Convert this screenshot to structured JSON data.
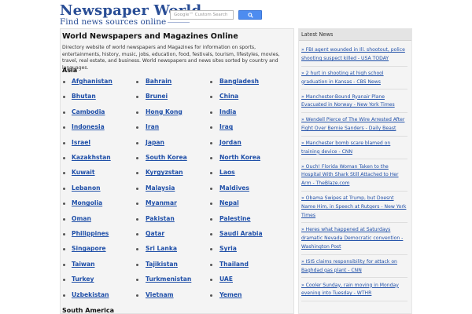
{
  "header": {
    "logo_title": "Newspaper World",
    "logo_subtitle": "Find news sources online",
    "search_placeholder": "Google™ Custom Search"
  },
  "main": {
    "title": "World Newspapers and Magazines Online",
    "intro": "Directory website of world newspapers and Magazines for information on sports, entertainments, history, music, jobs, education, food, festivals, tourism, lifestyles, movies, travel, real estate, and business. World newspapers and news sites sorted by country and languages.",
    "regions": [
      {
        "name": "Asia",
        "countries": [
          [
            "Afghanistan",
            "Bahrain",
            "Bangladesh"
          ],
          [
            "Bhutan",
            "Brunei",
            "China"
          ],
          [
            "Cambodia",
            "Hong Kong",
            "India"
          ],
          [
            "Indonesia",
            "Iran",
            "Iraq"
          ],
          [
            "Israel",
            "Japan",
            "Jordan"
          ],
          [
            "Kazakhstan",
            "South Korea",
            "North Korea"
          ],
          [
            "Kuwait",
            "Kyrgyzstan",
            "Laos"
          ],
          [
            "Lebanon",
            "Malaysia",
            "Maldives"
          ],
          [
            "Mongolia",
            "Myanmar",
            "Nepal"
          ],
          [
            "Oman",
            "Pakistan",
            "Palestine"
          ],
          [
            "Philippines",
            "Qatar",
            "Saudi Arabia"
          ],
          [
            "Singapore",
            "Sri Lanka",
            "Syria"
          ],
          [
            "Taiwan",
            "Tajikistan",
            "Thailand"
          ],
          [
            "Turkey",
            "Turkmenistan",
            "UAE"
          ],
          [
            "Uzbekistan",
            "Vietnam",
            "Yemen"
          ]
        ]
      },
      {
        "name": "South America",
        "countries": []
      }
    ]
  },
  "sidebar": {
    "title": "Latest News",
    "news": [
      "» FBI agent wounded in Ill. shootout, police shooting suspect killed - USA TODAY",
      "» 2 hurt in shooting at high school graduation in Kansas - CBS News",
      "» Manchester-Bound Ryanair Plane Evacuated in Norway - New York Times",
      "» Wendell Pierce of The Wire Arrested After Fight Over Bernie Sanders - Daily Beast",
      "» Manchester bomb scare blamed on training device - CNN",
      "» Ouch! Florida Woman Taken to the Hospital With Shark Still Attached to Her Arm - TheBlaze.com",
      "» Obama Swipes at Trump, but Doesnt Name Him, in Speech at Rutgers - New York Times",
      "» Heres what happened at Saturdays dramatic Nevada Democratic convention - Washington Post",
      "» ISIS claims responsibility for attack on Baghdad gas plant - CNN",
      "» Cooler Sunday, rain moving in Monday evening into Tuesday - WTHR"
    ]
  },
  "colors": {
    "link": "#1f4fa8",
    "logo": "#2a4e96",
    "search_button": "#4d8cf0"
  }
}
